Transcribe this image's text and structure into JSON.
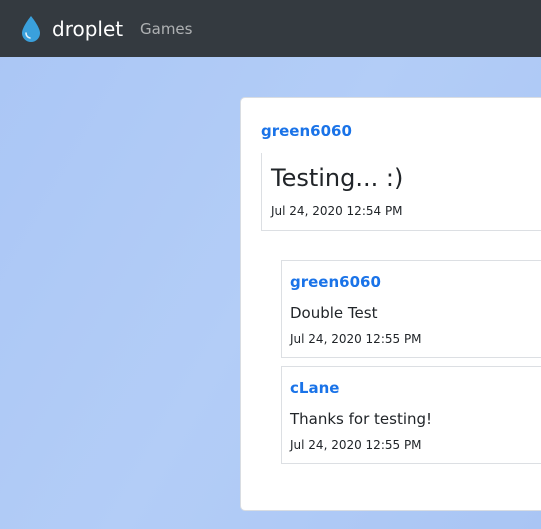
{
  "navbar": {
    "brand": "droplet",
    "links": [
      "Games"
    ]
  },
  "post": {
    "author": "green6060",
    "title": "Testing... :)",
    "date": "Jul 24, 2020 12:54 PM"
  },
  "replies": [
    {
      "author": "green6060",
      "text": "Double Test",
      "date": "Jul 24, 2020 12:55 PM"
    },
    {
      "author": "cLane",
      "text": "Thanks for testing!",
      "date": "Jul 24, 2020 12:55 PM"
    }
  ],
  "colors": {
    "navbar_bg": "#343a40",
    "page_bg": "#aac6f5",
    "link_blue": "#1a73e8",
    "droplet_blue": "#3aa0dc"
  }
}
